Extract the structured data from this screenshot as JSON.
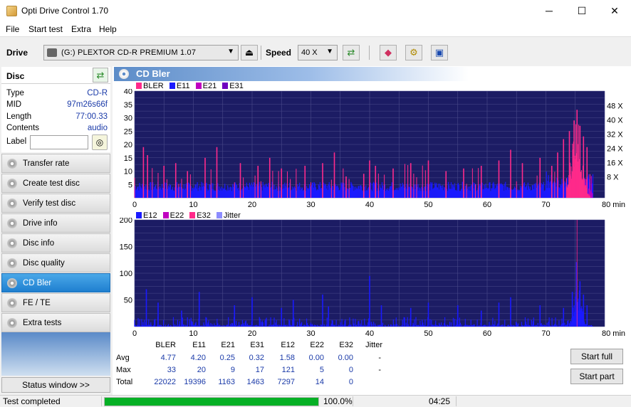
{
  "window": {
    "title": "Opti Drive Control 1.70",
    "minimize": "─",
    "maximize": "☐",
    "close": "✕"
  },
  "menu": [
    "File",
    "Start test",
    "Extra",
    "Help"
  ],
  "toolbar": {
    "drive_label": "Drive",
    "drive_value": "(G:)   PLEXTOR CD-R   PREMIUM 1.07",
    "speed_label": "Speed",
    "speed_value": "40 X",
    "icons": [
      "eject-icon",
      "refresh-icon",
      "eraser-icon",
      "settings-icon",
      "save-icon"
    ]
  },
  "disc": {
    "title": "Disc",
    "fields": [
      {
        "k": "Type",
        "v": "CD-R"
      },
      {
        "k": "MID",
        "v": "97m26s66f"
      },
      {
        "k": "Length",
        "v": "77:00.33"
      },
      {
        "k": "Contents",
        "v": "audio"
      }
    ],
    "label_key": "Label"
  },
  "nav": [
    {
      "label": "Transfer rate",
      "active": false
    },
    {
      "label": "Create test disc",
      "active": false
    },
    {
      "label": "Verify test disc",
      "active": false
    },
    {
      "label": "Drive info",
      "active": false
    },
    {
      "label": "Disc info",
      "active": false
    },
    {
      "label": "Disc quality",
      "active": false
    },
    {
      "label": "CD Bler",
      "active": true
    },
    {
      "label": "FE / TE",
      "active": false
    },
    {
      "label": "Extra tests",
      "active": false
    }
  ],
  "status_window": "Status window >>",
  "panel_title": "CD Bler",
  "colors": {
    "bler": "#ff2a8a",
    "e11": "#1a1aff",
    "e21": "#c000c0",
    "e31": "#7000c0",
    "e12": "#1a1aff",
    "e22": "#c000c0",
    "e32": "#ff2a8a",
    "jitter": "#8c8cff",
    "plot_bg": "#1c1c64",
    "grid": "#4a4a8a"
  },
  "chart_data": [
    {
      "type": "bar",
      "legend": [
        "BLER",
        "E11",
        "E21",
        "E31"
      ],
      "xticks": [
        "0",
        "10",
        "20",
        "30",
        "40",
        "50",
        "60",
        "70",
        "80 min"
      ],
      "xlim": [
        0,
        80
      ],
      "ylim": [
        0,
        40
      ],
      "yticks": [
        "5",
        "10",
        "15",
        "20",
        "25",
        "30",
        "35",
        "40"
      ],
      "y2ticks": [
        "8 X",
        "16 X",
        "24 X",
        "32 X",
        "40 X",
        "48 X"
      ],
      "spikes": [
        {
          "x": 1.5,
          "y": 19
        },
        {
          "x": 2.2,
          "y": 16
        },
        {
          "x": 5,
          "y": 12
        },
        {
          "x": 7,
          "y": 13
        },
        {
          "x": 9,
          "y": 10
        },
        {
          "x": 12,
          "y": 15
        },
        {
          "x": 14,
          "y": 19
        },
        {
          "x": 18,
          "y": 13
        },
        {
          "x": 21,
          "y": 12
        },
        {
          "x": 23,
          "y": 15
        },
        {
          "x": 25,
          "y": 11
        },
        {
          "x": 29,
          "y": 12
        },
        {
          "x": 32,
          "y": 13
        },
        {
          "x": 34,
          "y": 17
        },
        {
          "x": 36,
          "y": 8
        },
        {
          "x": 39,
          "y": 9
        },
        {
          "x": 40,
          "y": 14
        },
        {
          "x": 41,
          "y": 12
        },
        {
          "x": 44,
          "y": 11
        },
        {
          "x": 47,
          "y": 13
        },
        {
          "x": 50,
          "y": 14
        },
        {
          "x": 53,
          "y": 10
        },
        {
          "x": 56,
          "y": 11
        },
        {
          "x": 59,
          "y": 12
        },
        {
          "x": 62,
          "y": 14
        },
        {
          "x": 64,
          "y": 18
        },
        {
          "x": 66,
          "y": 13
        },
        {
          "x": 69,
          "y": 15
        },
        {
          "x": 71,
          "y": 12
        },
        {
          "x": 72,
          "y": 17
        },
        {
          "x": 73,
          "y": 22
        },
        {
          "x": 74,
          "y": 25
        },
        {
          "x": 74.8,
          "y": 29
        },
        {
          "x": 75.3,
          "y": 33
        },
        {
          "x": 75.8,
          "y": 27
        },
        {
          "x": 76.4,
          "y": 23
        },
        {
          "x": 77,
          "y": 19
        }
      ]
    },
    {
      "type": "bar",
      "legend": [
        "E12",
        "E22",
        "E32",
        "Jitter"
      ],
      "xticks": [
        "0",
        "10",
        "20",
        "30",
        "40",
        "50",
        "60",
        "70",
        "80 min"
      ],
      "xlim": [
        0,
        80
      ],
      "ylim": [
        0,
        200
      ],
      "yticks": [
        "50",
        "100",
        "150",
        "200"
      ],
      "spikes": [
        {
          "x": 2,
          "y": 70
        },
        {
          "x": 4,
          "y": 45
        },
        {
          "x": 8,
          "y": 30
        },
        {
          "x": 11,
          "y": 65
        },
        {
          "x": 17,
          "y": 40
        },
        {
          "x": 20,
          "y": 55
        },
        {
          "x": 25,
          "y": 35
        },
        {
          "x": 27,
          "y": 50
        },
        {
          "x": 32,
          "y": 60
        },
        {
          "x": 33,
          "y": 38
        },
        {
          "x": 40,
          "y": 95
        },
        {
          "x": 42,
          "y": 40
        },
        {
          "x": 47,
          "y": 35
        },
        {
          "x": 50,
          "y": 45
        },
        {
          "x": 55,
          "y": 40
        },
        {
          "x": 59,
          "y": 30
        },
        {
          "x": 62,
          "y": 45
        },
        {
          "x": 64,
          "y": 55
        },
        {
          "x": 69,
          "y": 40
        },
        {
          "x": 73,
          "y": 35
        },
        {
          "x": 74.5,
          "y": 65
        },
        {
          "x": 75.2,
          "y": 121
        },
        {
          "x": 75.8,
          "y": 85
        },
        {
          "x": 76.4,
          "y": 60
        },
        {
          "x": 77,
          "y": 40
        }
      ]
    }
  ],
  "stats": {
    "headers": [
      "BLER",
      "E11",
      "E21",
      "E31",
      "E12",
      "E22",
      "E32",
      "Jitter"
    ],
    "rows": [
      {
        "label": "Avg",
        "values": [
          "4.77",
          "4.20",
          "0.25",
          "0.32",
          "1.58",
          "0.00",
          "0.00",
          "-"
        ]
      },
      {
        "label": "Max",
        "values": [
          "33",
          "20",
          "9",
          "17",
          "121",
          "5",
          "0",
          "-"
        ]
      },
      {
        "label": "Total",
        "values": [
          "22022",
          "19396",
          "1163",
          "1463",
          "7297",
          "14",
          "0",
          ""
        ]
      }
    ]
  },
  "buttons": {
    "start_full": "Start full",
    "start_part": "Start part"
  },
  "statusbar": {
    "status": "Test completed",
    "progress": 1.0,
    "percent": "100.0%",
    "time": "04:25"
  }
}
